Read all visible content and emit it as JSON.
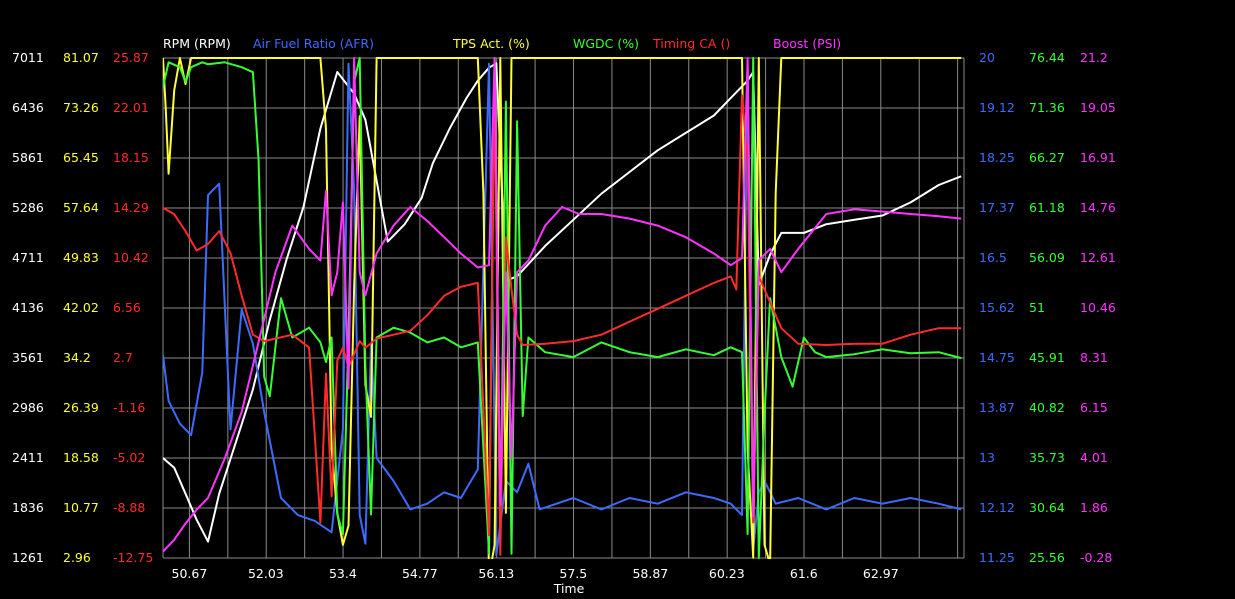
{
  "chart_data": {
    "type": "line",
    "xlabel": "Time",
    "x_ticks": [
      "50.67",
      "52.03",
      "53.4",
      "54.77",
      "56.13",
      "57.5",
      "58.87",
      "60.23",
      "61.6",
      "62.97"
    ],
    "xlim": [
      50.2,
      64.45
    ],
    "grid": true,
    "legend_position": "top",
    "axes": {
      "left": [
        {
          "color": "#ffffff",
          "ticks": [
            "7011",
            "6436",
            "5861",
            "5286",
            "4711",
            "4136",
            "3561",
            "2986",
            "2411",
            "1836",
            "1261"
          ]
        },
        {
          "color": "#ffff33",
          "ticks": [
            "81.07",
            "73.26",
            "65.45",
            "57.64",
            "49.83",
            "42.02",
            "34.2",
            "26.39",
            "18.58",
            "10.77",
            "2.96"
          ]
        },
        {
          "color": "#ff2a2a",
          "ticks": [
            "25.87",
            "22.01",
            "18.15",
            "14.29",
            "10.42",
            "6.56",
            "2.7",
            "-1.16",
            "-5.02",
            "-8.88",
            "-12.75"
          ]
        }
      ],
      "right": [
        {
          "color": "#3d6bff",
          "ticks": [
            "20",
            "19.12",
            "18.25",
            "17.37",
            "16.5",
            "15.62",
            "14.75",
            "13.87",
            "13",
            "12.12",
            "11.25"
          ]
        },
        {
          "color": "#33ff33",
          "ticks": [
            "76.44",
            "71.36",
            "66.27",
            "61.18",
            "56.09",
            "51",
            "45.91",
            "40.82",
            "35.73",
            "30.64",
            "25.56"
          ]
        },
        {
          "color": "#ff33ff",
          "ticks": [
            "21.2",
            "19.05",
            "16.91",
            "14.76",
            "12.61",
            "10.46",
            "8.31",
            "6.15",
            "4.01",
            "1.86",
            "-0.28"
          ]
        }
      ]
    },
    "series": [
      {
        "name": "RPM (RPM)",
        "color": "#ffffff",
        "x": [
          50.2,
          50.4,
          50.6,
          50.8,
          51.0,
          51.2,
          51.5,
          51.8,
          52.1,
          52.4,
          52.7,
          53.0,
          53.3,
          53.6,
          53.8,
          54.0,
          54.2,
          54.5,
          54.8,
          55.0,
          55.3,
          55.6,
          55.8,
          56.0,
          56.13,
          56.3,
          56.5,
          57.0,
          57.5,
          58.0,
          58.5,
          59.0,
          59.5,
          60.0,
          60.3,
          60.6,
          60.7,
          60.8,
          61.0,
          61.2,
          61.6,
          62.0,
          62.5,
          63.0,
          63.5,
          64.0,
          64.4
        ],
        "y": [
          2411,
          2300,
          2000,
          1700,
          1450,
          2000,
          2600,
          3200,
          4000,
          4700,
          5300,
          6200,
          6850,
          6600,
          6300,
          5600,
          4900,
          5100,
          5400,
          5800,
          6200,
          6550,
          6750,
          6900,
          6950,
          4450,
          4500,
          4850,
          5150,
          5450,
          5700,
          5950,
          6150,
          6350,
          6550,
          6750,
          6850,
          4400,
          4750,
          5000,
          5000,
          5100,
          5150,
          5200,
          5350,
          5550,
          5650
        ]
      },
      {
        "name": "Air Fuel Ratio (AFR)",
        "color": "#3d6bff",
        "x": [
          50.2,
          50.3,
          50.5,
          50.7,
          50.9,
          51.0,
          51.2,
          51.4,
          51.6,
          51.8,
          52.0,
          52.3,
          52.6,
          52.9,
          53.2,
          53.4,
          53.5,
          53.6,
          53.7,
          53.8,
          53.9,
          54.0,
          54.3,
          54.6,
          54.9,
          55.2,
          55.5,
          55.8,
          56.0,
          56.13,
          56.3,
          56.5,
          56.7,
          56.9,
          57.2,
          57.5,
          58.0,
          58.5,
          59.0,
          59.5,
          60.0,
          60.3,
          60.5,
          60.6,
          60.7,
          60.8,
          60.9,
          61.1,
          61.5,
          62.0,
          62.5,
          63.0,
          63.5,
          64.0,
          64.4
        ],
        "y": [
          14.8,
          14.0,
          13.6,
          13.4,
          14.5,
          17.6,
          17.8,
          13.5,
          15.6,
          15.0,
          13.8,
          12.3,
          12.0,
          11.9,
          11.7,
          13.5,
          19.9,
          17.7,
          12.0,
          11.5,
          15.0,
          13.0,
          12.6,
          12.1,
          12.2,
          12.4,
          12.3,
          12.8,
          19.9,
          11.3,
          12.6,
          12.4,
          12.9,
          12.1,
          12.2,
          12.3,
          12.1,
          12.3,
          12.2,
          12.4,
          12.3,
          12.2,
          12.0,
          19.9,
          11.4,
          12.4,
          12.6,
          12.2,
          12.3,
          12.1,
          12.3,
          12.2,
          12.3,
          12.2,
          12.1
        ]
      },
      {
        "name": "TPS Act. (%)",
        "color": "#ffff33",
        "x": [
          50.2,
          50.25,
          50.3,
          50.4,
          50.5,
          50.6,
          50.7,
          50.8,
          51.0,
          51.5,
          52.0,
          52.5,
          53.0,
          53.1,
          53.2,
          53.3,
          53.4,
          53.5,
          53.6,
          53.7,
          53.8,
          53.9,
          54.0,
          55.5,
          55.8,
          55.9,
          56.0,
          56.1,
          56.2,
          56.3,
          56.4,
          56.5,
          56.6,
          58.0,
          60.0,
          60.5,
          60.6,
          60.7,
          60.8,
          60.9,
          61.0,
          61.1,
          61.2,
          61.3,
          62.0,
          64.4
        ],
        "y": [
          81.07,
          73.0,
          63.0,
          76.0,
          81.07,
          77.0,
          81.07,
          81.07,
          81.07,
          81.07,
          81.07,
          81.07,
          81.07,
          70.0,
          20.0,
          10.0,
          5.0,
          8.0,
          45.0,
          72.0,
          30.0,
          25.0,
          81.07,
          81.07,
          81.07,
          60.0,
          0.0,
          5.0,
          81.07,
          10.0,
          81.07,
          81.07,
          81.07,
          81.07,
          81.07,
          81.07,
          20.0,
          3.0,
          81.07,
          5.0,
          2.0,
          60.0,
          81.07,
          81.07,
          81.07,
          81.07
        ]
      },
      {
        "name": "WGDC (%)",
        "color": "#33ff33",
        "x": [
          50.2,
          50.3,
          50.5,
          50.6,
          50.7,
          50.9,
          51.0,
          51.3,
          51.6,
          51.8,
          51.9,
          52.0,
          52.1,
          52.3,
          52.5,
          52.8,
          53.0,
          53.1,
          53.2,
          53.3,
          53.4,
          53.5,
          53.6,
          53.7,
          53.8,
          53.9,
          54.0,
          54.3,
          54.6,
          54.9,
          55.2,
          55.5,
          55.8,
          56.0,
          56.1,
          56.2,
          56.3,
          56.4,
          56.5,
          56.6,
          56.7,
          57.0,
          57.5,
          58.0,
          58.5,
          59.0,
          59.5,
          60.0,
          60.3,
          60.5,
          60.6,
          60.7,
          60.8,
          60.9,
          61.0,
          61.2,
          61.4,
          61.6,
          61.8,
          62.0,
          62.5,
          63.0,
          63.5,
          64.0,
          64.4
        ],
        "y": [
          73.5,
          76.0,
          75.5,
          74.0,
          75.5,
          76.0,
          75.8,
          76.0,
          75.5,
          75.0,
          66.0,
          44.0,
          42.0,
          52.0,
          48.0,
          49.0,
          47.5,
          45.5,
          48.0,
          30.0,
          28.0,
          48.0,
          74.0,
          76.44,
          45.0,
          30.0,
          48.0,
          49.0,
          48.5,
          47.5,
          48.0,
          47.0,
          47.5,
          26.0,
          76.44,
          27.0,
          72.0,
          26.0,
          70.0,
          40.0,
          48.0,
          46.5,
          46.0,
          47.5,
          46.5,
          46.0,
          46.8,
          46.2,
          47.0,
          46.5,
          28.0,
          76.44,
          25.56,
          40.0,
          52.0,
          46.0,
          43.0,
          48.0,
          46.5,
          46.0,
          46.3,
          46.8,
          46.4,
          46.5,
          45.9
        ]
      },
      {
        "name": "Timing CA ()",
        "color": "#ff2a2a",
        "x": [
          50.2,
          50.4,
          50.6,
          50.8,
          51.0,
          51.2,
          51.4,
          51.6,
          51.8,
          52.0,
          52.2,
          52.5,
          52.8,
          53.0,
          53.1,
          53.2,
          53.3,
          53.4,
          53.5,
          53.6,
          53.7,
          53.8,
          54.0,
          54.3,
          54.6,
          54.9,
          55.2,
          55.5,
          55.8,
          56.0,
          56.1,
          56.2,
          56.3,
          56.4,
          56.5,
          56.6,
          57.0,
          57.5,
          58.0,
          58.5,
          59.0,
          59.5,
          60.0,
          60.3,
          60.4,
          60.5,
          60.6,
          60.7,
          60.8,
          61.0,
          61.2,
          61.5,
          62.0,
          62.5,
          63.0,
          63.5,
          64.0,
          64.4
        ],
        "y": [
          14.3,
          13.8,
          12.5,
          11.0,
          11.5,
          12.5,
          10.8,
          7.5,
          4.5,
          4.0,
          4.2,
          4.5,
          3.5,
          -10.0,
          1.5,
          -8.0,
          2.5,
          3.5,
          2.0,
          3.0,
          4.0,
          3.5,
          4.2,
          4.5,
          4.8,
          6.0,
          7.5,
          8.2,
          8.5,
          -11.0,
          24.0,
          -12.5,
          12.0,
          8.0,
          4.5,
          3.7,
          3.8,
          4.0,
          4.5,
          5.5,
          6.5,
          7.5,
          8.5,
          9.0,
          8.0,
          23.0,
          18.0,
          -10.0,
          9.0,
          7.0,
          5.0,
          3.8,
          3.7,
          3.8,
          3.8,
          4.5,
          5.0,
          5.0
        ]
      },
      {
        "name": "Boost (PSI)",
        "color": "#ff33ff",
        "x": [
          50.2,
          50.4,
          50.6,
          50.8,
          51.0,
          51.3,
          51.6,
          51.9,
          52.2,
          52.5,
          52.8,
          53.0,
          53.1,
          53.2,
          53.3,
          53.4,
          53.5,
          53.6,
          53.7,
          53.8,
          54.0,
          54.3,
          54.6,
          54.9,
          55.2,
          55.5,
          55.8,
          56.0,
          56.1,
          56.2,
          56.3,
          56.4,
          56.5,
          56.7,
          57.0,
          57.3,
          57.6,
          58.0,
          58.5,
          59.0,
          59.5,
          60.0,
          60.3,
          60.5,
          60.6,
          60.7,
          60.8,
          61.0,
          61.2,
          61.5,
          62.0,
          62.5,
          63.0,
          63.5,
          64.0,
          64.4
        ],
        "y": [
          0.0,
          0.5,
          1.2,
          1.8,
          2.3,
          4.0,
          6.0,
          9.0,
          12.0,
          14.0,
          13.0,
          12.5,
          15.5,
          11.0,
          12.0,
          15.0,
          7.0,
          21.2,
          12.0,
          11.0,
          12.8,
          14.0,
          14.8,
          14.2,
          13.5,
          12.8,
          12.2,
          12.3,
          21.2,
          2.0,
          12.0,
          4.0,
          12.0,
          12.5,
          14.0,
          14.8,
          14.5,
          14.5,
          14.3,
          14.0,
          13.5,
          12.8,
          12.3,
          12.6,
          21.2,
          1.5,
          12.5,
          13.0,
          12.0,
          13.0,
          14.5,
          14.7,
          14.6,
          14.5,
          14.4,
          14.3
        ]
      }
    ]
  }
}
